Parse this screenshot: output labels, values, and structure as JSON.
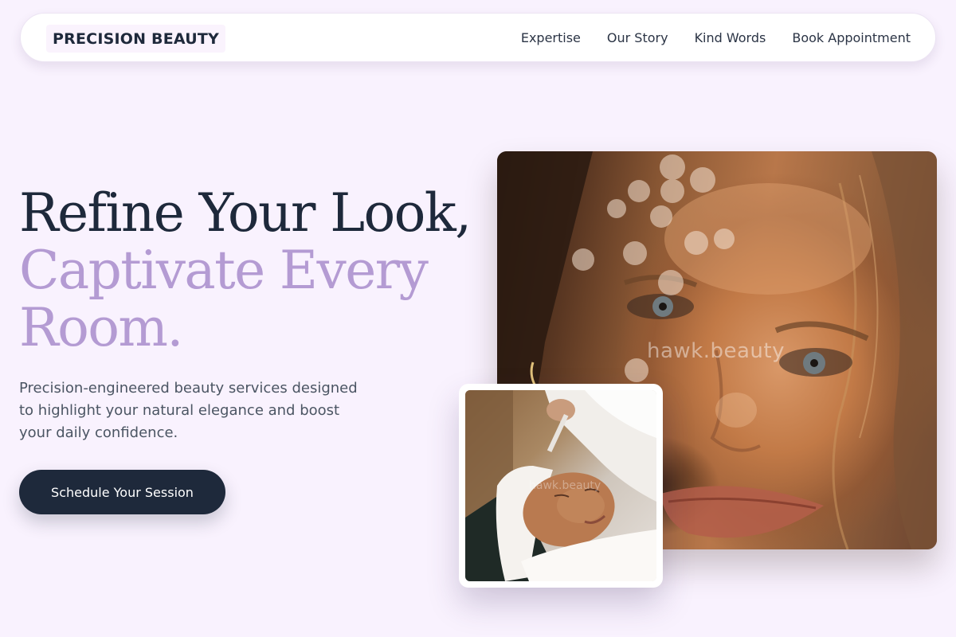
{
  "header": {
    "brand": "PRECISION BEAUTY",
    "nav": [
      "Expertise",
      "Our Story",
      "Kind Words",
      "Book Appointment"
    ]
  },
  "hero": {
    "headline_line1": "Refine Your Look,",
    "headline_line2": "Captivate Every",
    "headline_line3": "Room.",
    "subtext": "Precision-engineered beauty services designed to highlight your natural elegance and boost your daily confidence.",
    "cta_label": "Schedule Your Session"
  },
  "images": {
    "portrait_watermark": "hawk.beauty",
    "treatment_watermark": "hawk.beauty"
  },
  "colors": {
    "background": "#f9f2fe",
    "primary_text": "#1e293b",
    "accent": "#b49bd3",
    "cta_background": "#1e293b"
  }
}
